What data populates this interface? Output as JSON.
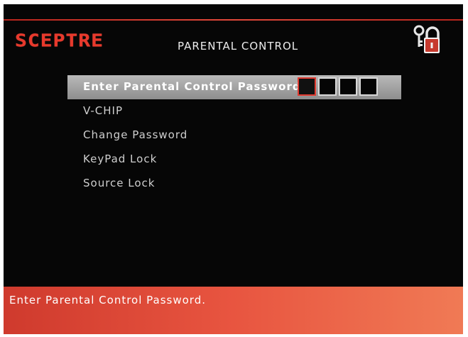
{
  "header": {
    "brand": "SCEPTRE",
    "title": "PARENTAL CONTROL",
    "icon": "lock-with-key-icon"
  },
  "menu": {
    "items": [
      {
        "label": "Enter Parental Control Password",
        "selected": true
      },
      {
        "label": "V-CHIP",
        "selected": false
      },
      {
        "label": "Change Password",
        "selected": false
      },
      {
        "label": "KeyPad Lock",
        "selected": false
      },
      {
        "label": "Source Lock",
        "selected": false
      }
    ]
  },
  "password": {
    "digit_count": 4,
    "active_index": 0
  },
  "status": {
    "message": "Enter Parental Control Password."
  },
  "colors": {
    "brand": "#e8392c",
    "background": "#060606",
    "status_bar": "#e85540",
    "selection": "#a5a5a5"
  }
}
